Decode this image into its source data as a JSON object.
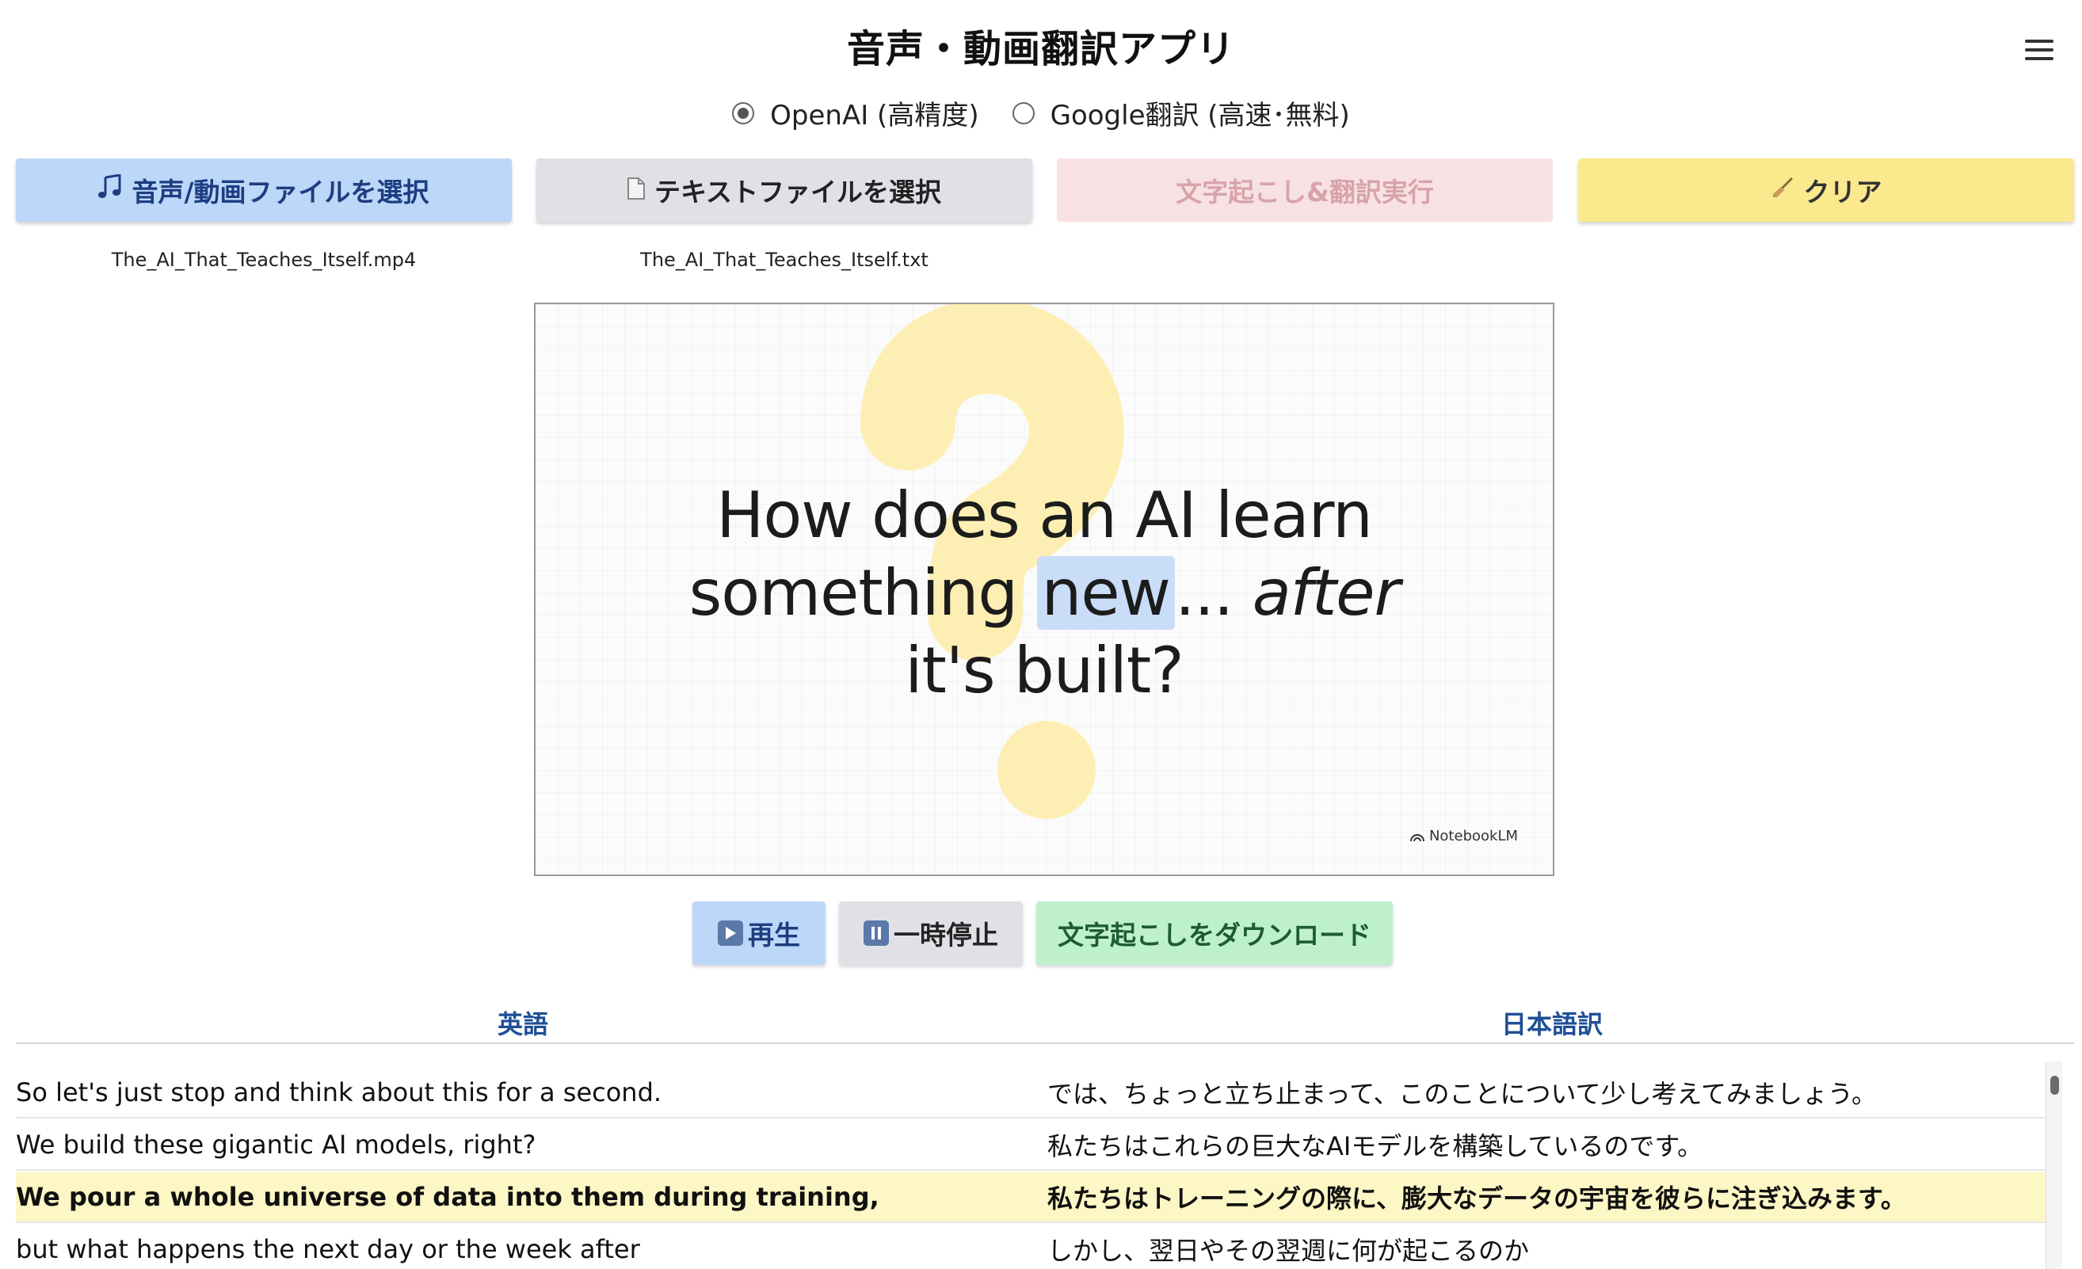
{
  "app": {
    "title": "音声・動画翻訳アプリ"
  },
  "engine": {
    "options": [
      {
        "label": "OpenAI (高精度)",
        "selected": true
      },
      {
        "label": "Google翻訳 (高速･無料)",
        "selected": false
      }
    ]
  },
  "toolbar": {
    "select_media_label": "音声/動画ファイルを選択",
    "select_media_icon": "music-note-icon",
    "select_text_label": "テキストファイルを選択",
    "select_text_icon": "file-icon",
    "run_label": "文字起こし&翻訳実行",
    "run_enabled": false,
    "clear_label": "クリア",
    "clear_icon": "broom-icon"
  },
  "files": {
    "media": "The_AI_That_Teaches_Itself.mp4",
    "text": "The_AI_That_Teaches_Itself.txt"
  },
  "video": {
    "line1": "How does an AI learn",
    "line2_a": "something ",
    "line2_highlight": "new",
    "line2_b": "... ",
    "line2_italic": "after",
    "line3": "it's built?",
    "watermark": "NotebookLM"
  },
  "controls": {
    "play_label": "再生",
    "pause_label": "一時停止",
    "download_label": "文字起こしをダウンロード"
  },
  "transcript": {
    "headers": {
      "english": "英語",
      "japanese": "日本語訳"
    },
    "active_index": 2,
    "rows": [
      {
        "en": "So let's just stop and think about this for a second.",
        "ja": "では、ちょっと立ち止まって、このことについて少し考えてみましょう。"
      },
      {
        "en": "We build these gigantic AI models, right?",
        "ja": "私たちはこれらの巨大なAIモデルを構築しているのです。"
      },
      {
        "en": "We pour a whole universe of data into them during training,",
        "ja": "私たちはトレーニングの際に、膨大なデータの宇宙を彼らに注ぎ込みます。"
      },
      {
        "en": "but what happens the next day or the week after",
        "ja": "しかし、翌日やその翌週に何が起こるのか"
      }
    ]
  },
  "colors": {
    "primary_btn": "#bcd7f7",
    "secondary_btn": "#e0e1e6",
    "disabled_btn": "#f8e1e3",
    "clear_btn": "#fbe98d",
    "download_btn": "#bff0cc",
    "active_row": "#fdf6c5",
    "header_text": "#1f4f96"
  }
}
